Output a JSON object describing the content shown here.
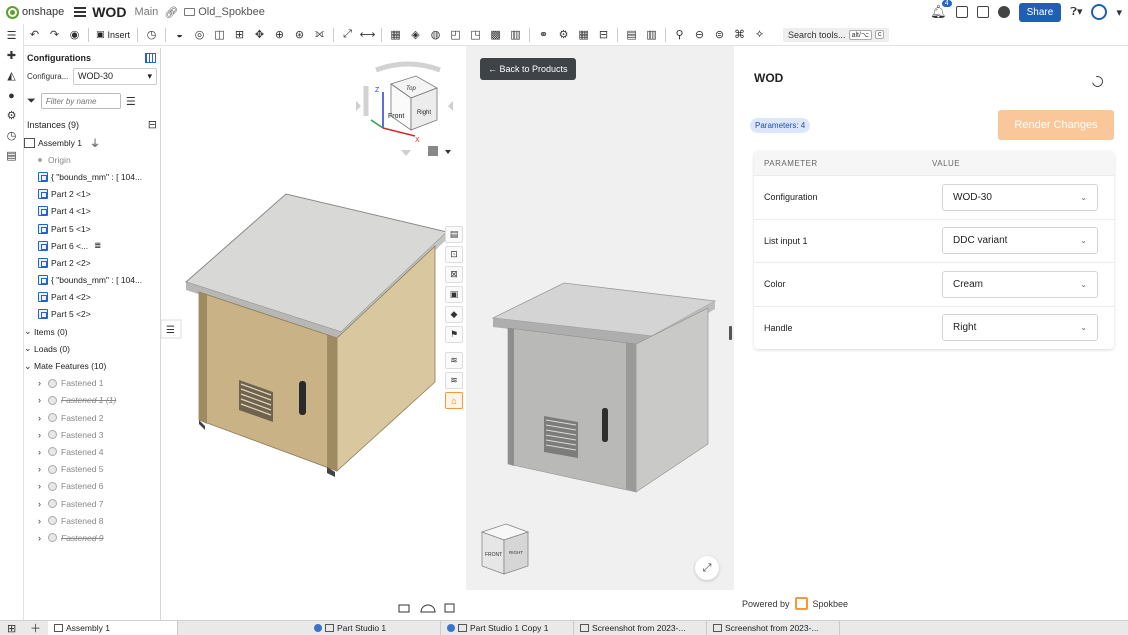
{
  "header": {
    "brand": "onshape",
    "doc_title": "WOD",
    "branch": "Main",
    "folder": "Old_Spokbee",
    "notifications": "4",
    "share_label": "Share"
  },
  "toolbar": {
    "insert_label": "Insert",
    "search_label": "Search tools...",
    "shortcut_1": "alt/⌥",
    "shortcut_2": "c"
  },
  "left_panel": {
    "title": "Configurations",
    "config_label": "Configura...",
    "config_value": "WOD-30",
    "filter_placeholder": "Filter by name",
    "instances_label": "Instances (9)",
    "instances": [
      {
        "label": "Assembly 1",
        "kind": "assembly"
      },
      {
        "label": "Origin",
        "kind": "origin"
      },
      {
        "label": "{ \"bounds_mm\" : [ 104...",
        "kind": "part"
      },
      {
        "label": "Part 2 <1>",
        "kind": "part"
      },
      {
        "label": "Part 4 <1>",
        "kind": "part"
      },
      {
        "label": "Part 5 <1>",
        "kind": "part"
      },
      {
        "label": "Part 6 <...",
        "kind": "part"
      },
      {
        "label": "Part 2 <2>",
        "kind": "part"
      },
      {
        "label": "{ \"bounds_mm\" : [ 104...",
        "kind": "part"
      },
      {
        "label": "Part 4 <2>",
        "kind": "part"
      },
      {
        "label": "Part 5 <2>",
        "kind": "part"
      }
    ],
    "groups": [
      {
        "label": "Items (0)"
      },
      {
        "label": "Loads (0)"
      },
      {
        "label": "Mate Features (10)"
      }
    ],
    "mates": [
      {
        "label": "Fastened 1",
        "suppressed": false
      },
      {
        "label": "Fastened 1 (1)",
        "suppressed": true
      },
      {
        "label": "Fastened 2",
        "suppressed": false
      },
      {
        "label": "Fastened 3",
        "suppressed": false
      },
      {
        "label": "Fastened 4",
        "suppressed": false
      },
      {
        "label": "Fastened 5",
        "suppressed": false
      },
      {
        "label": "Fastened 6",
        "suppressed": false
      },
      {
        "label": "Fastened 7",
        "suppressed": false
      },
      {
        "label": "Fastened 8",
        "suppressed": false
      },
      {
        "label": "Fastened 9",
        "suppressed": true
      }
    ]
  },
  "viewcube": {
    "face_top": "Top",
    "face_front": "Front",
    "face_right": "Right",
    "axis_x": "X",
    "axis_z": "Z"
  },
  "embed": {
    "back_label": "← Back to Products",
    "mini_cube_front": "FRONT",
    "mini_cube_right": "RIGHT",
    "title": "WOD",
    "params_badge": "Parameters: 4",
    "render_label": "Render Changes",
    "col_param": "PARAMETER",
    "col_value": "VALUE",
    "params": [
      {
        "label": "Configuration",
        "value": "WOD-30"
      },
      {
        "label": "List input 1",
        "value": "DDC variant"
      },
      {
        "label": "Color",
        "value": "Cream"
      },
      {
        "label": "Handle",
        "value": "Right"
      }
    ],
    "powered_by": "Powered by",
    "spokbee": "Spokbee"
  },
  "tabs": [
    {
      "label": "Assembly 1",
      "active": true
    },
    {
      "label": "Part Studio 1",
      "active": false
    },
    {
      "label": "Part Studio 1 Copy 1",
      "active": false
    },
    {
      "label": "Screenshot from 2023-...",
      "active": false
    },
    {
      "label": "Screenshot from 2023-...",
      "active": false
    }
  ],
  "colors": {
    "accent": "#1f5fb8",
    "render_button": "#f9c79a",
    "enclosure_beige": "#c9b286",
    "enclosure_steel": "#b8b8b6"
  }
}
